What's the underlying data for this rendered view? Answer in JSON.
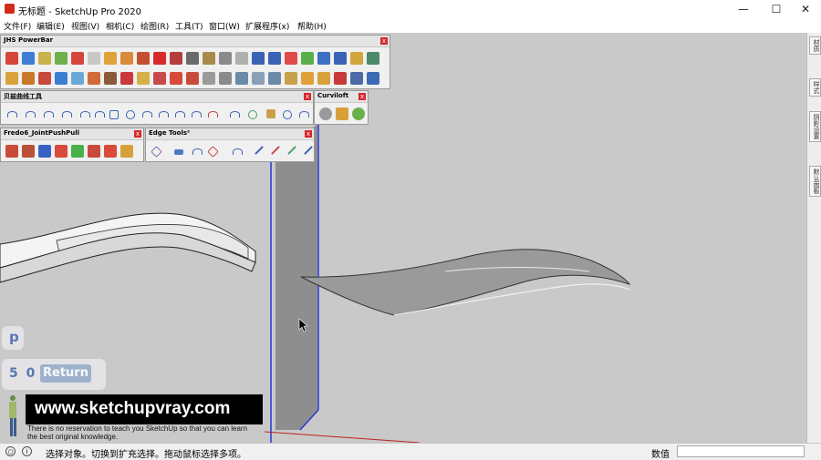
{
  "window": {
    "title": "无标题 - SketchUp Pro 2020",
    "min": "—",
    "max": "☐",
    "close": "✕"
  },
  "menu": [
    "文件(F)",
    "编辑(E)",
    "视图(V)",
    "相机(C)",
    "绘图(R)",
    "工具(T)",
    "窗口(W)",
    "扩展程序(x)",
    "帮助(H)"
  ],
  "toolbars": {
    "jhs": {
      "title": "JHS PowerBar"
    },
    "bezier": {
      "title": "贝兹曲线工具"
    },
    "curviloft": {
      "title": "Curviloft"
    },
    "fredo": {
      "title": "Fredo6_JointPushPull"
    },
    "edge": {
      "title": "Edge Tools²"
    },
    "close_glyph": "x"
  },
  "tray_tabs": [
    "材质",
    "样式",
    "阴影设置",
    "默认面板"
  ],
  "vcb": {
    "key": "p",
    "digits": "5 0",
    "return_label": "Return"
  },
  "watermark": {
    "site": "www.sketchupvray.com",
    "caption_line1": "There is no reservation to teach you SketchUp so that you can learn",
    "caption_line2": "the best original knowledge."
  },
  "status": {
    "message": "选择对象。切换到扩充选择。拖动鼠标选择多项。",
    "measure_label": "数值",
    "measure_value": ""
  },
  "colors": {
    "viewport": "#c9c9c9",
    "close_red": "#d8262b",
    "blue_axis": "#2437d6",
    "accent": "#d3291e"
  }
}
